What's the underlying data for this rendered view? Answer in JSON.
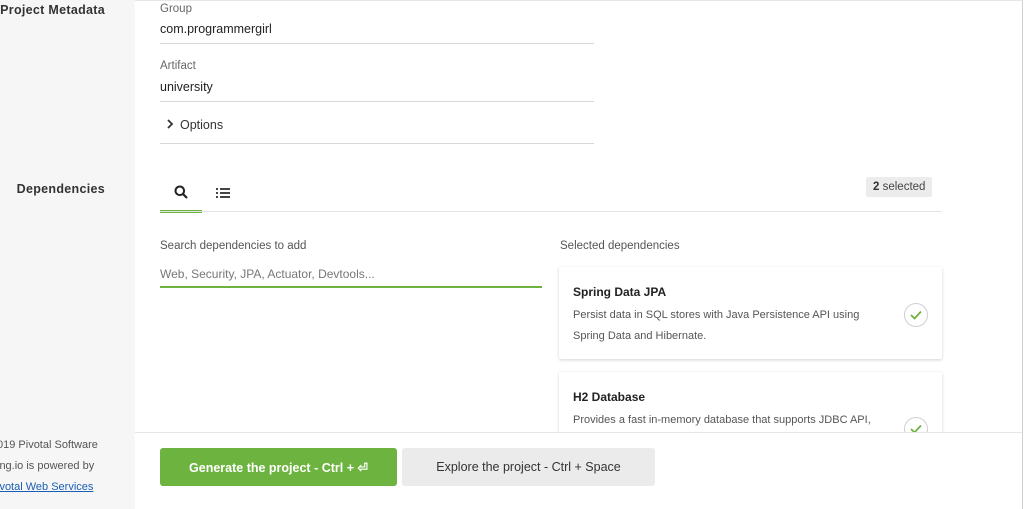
{
  "sidebar": {
    "project_metadata_label": "Project Metadata",
    "dependencies_label": "Dependencies",
    "footer": {
      "line1": "019 Pivotal Software",
      "line2": "ing.io is powered by",
      "link": "ivotal Web Services"
    }
  },
  "metadata": {
    "group_label": "Group",
    "group_value": "com.programmergirl",
    "artifact_label": "Artifact",
    "artifact_value": "university",
    "options_label": "Options"
  },
  "dependencies": {
    "tabs": [
      {
        "name": "search",
        "icon": "search-icon",
        "active": true
      },
      {
        "name": "list",
        "icon": "list-icon",
        "active": false
      }
    ],
    "selected_count": "2",
    "selected_suffix": "selected",
    "search_label": "Search dependencies to add",
    "search_placeholder": "Web, Security, JPA, Actuator, Devtools...",
    "selected_label": "Selected dependencies",
    "selected": [
      {
        "title": "Spring Data JPA",
        "description": "Persist data in SQL stores with Java Persistence API using Spring Data and Hibernate."
      },
      {
        "title": "H2 Database",
        "description": "Provides a fast in-memory database that supports JDBC API,"
      }
    ]
  },
  "actions": {
    "generate_label": "Generate the project - Ctrl + ⏎",
    "explore_label": "Explore the project - Ctrl + Space"
  },
  "colors": {
    "accent": "#6db33f",
    "sidebar_bg": "#f6f6f6"
  }
}
